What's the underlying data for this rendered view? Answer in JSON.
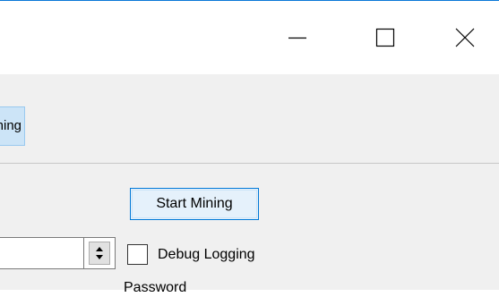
{
  "window": {
    "controls": {
      "minimize_icon": "minimize-icon",
      "maximize_icon": "maximize-icon",
      "close_icon": "close-icon"
    },
    "accent_color": "#0a78d7"
  },
  "tabs": [
    {
      "label": "Mining",
      "selected": true
    }
  ],
  "mining_panel": {
    "start_button_label": "Start Mining",
    "threads_input_value": "",
    "debug_logging_label": "Debug Logging",
    "debug_logging_checked": false,
    "cut_off_label": "Password"
  }
}
